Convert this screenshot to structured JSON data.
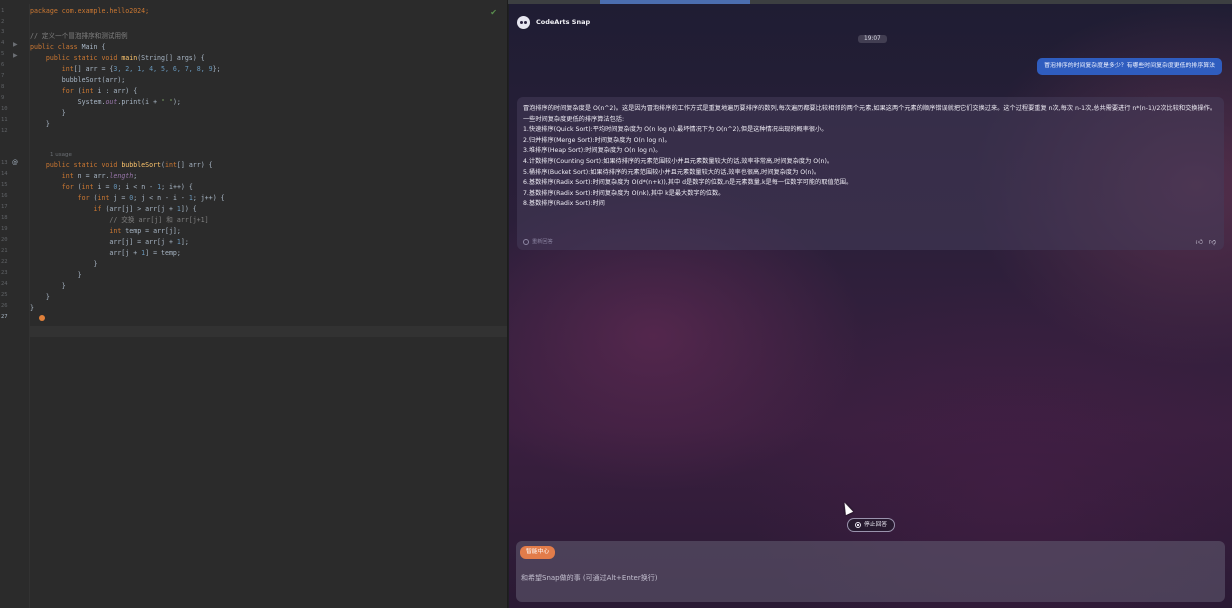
{
  "editor": {
    "line_numbers": [
      "1",
      "2",
      "3",
      "4",
      "5",
      "6",
      "7",
      "8",
      "9",
      "10",
      "11",
      "12",
      "",
      "13",
      "14",
      "15",
      "16",
      "17",
      "18",
      "19",
      "20",
      "21",
      "22",
      "23",
      "24",
      "25",
      "26",
      "27"
    ],
    "code": {
      "l1": "package com.example.hello2024;",
      "l3": "// 定义一个冒泡排序和测试用例",
      "l4a": "public class ",
      "l4b": "Main {",
      "l5a": "    public static void ",
      "l5b": "main",
      "l5c": "(String[] args) {",
      "l6a": "        int",
      "l6b": "[] arr = {",
      "l6c": "3, 2, 1, 4, 5, 6, 7, 8, 9",
      "l6d": "};",
      "l7": "        bubbleSort(arr);",
      "l8a": "        for ",
      "l8b": "(",
      "l8c": "int ",
      "l8d": "i : arr) {",
      "l9a": "            System.",
      "l9b": "out",
      "l9c": ".print(i + ",
      "l9d": "\" \"",
      "l9e": ");",
      "l10": "        }",
      "l11": "    }",
      "usage": "1 usage",
      "l13a": "    public static void ",
      "l13b": "bubbleSort",
      "l13c": "(",
      "l13d": "int",
      "l13e": "[] arr) {",
      "l14a": "        int ",
      "l14b": "n = arr.",
      "l14c": "length",
      "l14d": ";",
      "l15a": "        for ",
      "l15b": "(",
      "l15c": "int ",
      "l15d": "i = ",
      "l15e": "0",
      "l15f": "; i < n - ",
      "l15g": "1",
      "l15h": "; i++) {",
      "l16a": "            for ",
      "l16b": "(",
      "l16c": "int ",
      "l16d": "j = ",
      "l16e": "0",
      "l16f": "; j < n - i - ",
      "l16g": "1",
      "l16h": "; j++) {",
      "l17a": "                if ",
      "l17b": "(arr[j] > arr[j + ",
      "l17c": "1",
      "l17d": "]) {",
      "l18": "                    // 交换 arr[j] 和 arr[j+1]",
      "l19a": "                    int ",
      "l19b": "temp = arr[j];",
      "l20a": "                    arr[j] = arr[j + ",
      "l20b": "1",
      "l20c": "];",
      "l21a": "                    arr[j + ",
      "l21b": "1",
      "l21c": "] = temp;",
      "l22": "                }",
      "l23": "            }",
      "l24": "        }",
      "l25": "    }",
      "l26": "}"
    }
  },
  "chat": {
    "title": "CodeArts Snap",
    "time": "19:07",
    "user_message": "冒泡排序的时间复杂度是多少？有哪些时间复杂度更低的排序算法",
    "answer_lines": [
      "冒泡排序的时间复杂度是 O(n^2)。这是因为冒泡排序的工作方式是重复地遍历要排序的数列,每次遍历都要比较相邻的两个元素,如果这两个元素的顺序错误就把它们交换过来。这个过程要重复 n次,每次 n-1次,总共需要进行 n*(n-1)/2次比较和交换操作。",
      "一些时间复杂度更低的排序算法包括:",
      "1.快速排序(Quick Sort):平均时间复杂度为 O(n log n),最坏情况下为 O(n^2),但是这种情况出现的概率很小。",
      "2.归并排序(Merge Sort):时间复杂度为 O(n log n)。",
      "3.堆排序(Heap Sort):时间复杂度为 O(n log n)。",
      "4.计数排序(Counting Sort):如果待排序的元素范围较小并且元素数量较大的话,效率非常高,时间复杂度为 O(n)。",
      "5.桶排序(Bucket Sort):如果待排序的元素范围较小并且元素数量较大的话,效率也很高,时间复杂度为 O(n)。",
      "6.基数排序(Radix Sort):时间复杂度为 O(d*(n+k)),其中 d是数字的位数,n是元素数量,k是每一位数字可能的取值范围。",
      "7.基数排序(Radix Sort):时间复杂度为 O(nk),其中 k是最大数字的位数。",
      "8.基数排序(Radix Sort):时间"
    ],
    "regenerate_label": "重新回答",
    "stop_label": "停止回答",
    "agent_chip": "智能中心",
    "input_placeholder": "和希望Snap做的事 (可通过Alt+Enter换行)"
  }
}
